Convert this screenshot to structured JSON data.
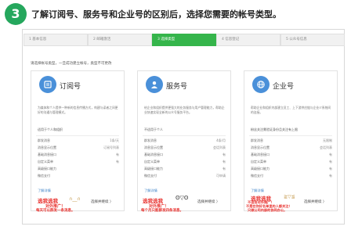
{
  "step_number": "3",
  "heading": "了解订阅号、服务号和企业号的区别后，选择您需要的帐号类型。",
  "steps": [
    {
      "label": "1 基本信息"
    },
    {
      "label": "2 邮箱激活"
    },
    {
      "label": "3 选择类型"
    },
    {
      "label": "4 信息登记"
    },
    {
      "label": "5 公众号信息"
    }
  ],
  "prompt": "请选择帐号类型，一旦成功建立帐号，类型不可更改",
  "cards": [
    {
      "title": "订阅号",
      "desc": "为媒体和个人提供一种新的信息传播方式，构建与读者之间更好的沟通与管理模式。",
      "note": "适用于个人和组织",
      "features": [
        {
          "label": "群发消息",
          "value": "1条/天"
        },
        {
          "label": "消息显示位置",
          "value": "订阅号列表"
        },
        {
          "label": "基础消息接口",
          "value": "有"
        },
        {
          "label": "自定义菜单",
          "value": "有"
        },
        {
          "label": "高级接口能力",
          "value": ""
        },
        {
          "label": "微信支付",
          "value": ""
        }
      ],
      "learn": "了解详情",
      "handwriting": [
        "选我选我",
        "对外推广！",
        "每天可以群发一条消息。"
      ],
      "face": "∩__∩",
      "select": "选择并继续 〉"
    },
    {
      "title": "服务号",
      "desc": "给企业和组织提供更强大的业务服务与用户管理能力，帮助企业快速实现全新的公众号服务平台。",
      "note": "不适用于个人",
      "features": [
        {
          "label": "群发消息",
          "value": "4条/月"
        },
        {
          "label": "消息显示位置",
          "value": "会话列表"
        },
        {
          "label": "基础消息接口",
          "value": "有"
        },
        {
          "label": "自定义菜单",
          "value": "有"
        },
        {
          "label": "高级接口能力",
          "value": "有"
        },
        {
          "label": "微信支付",
          "value": "可申请"
        }
      ],
      "learn": "了解详情",
      "handwriting": [
        "选我选我",
        "对外推广！",
        "每个月只能群发四条消息。"
      ],
      "face": "ʘ▽ʘ",
      "select": "选择并继续 〉"
    },
    {
      "title": "企业号",
      "desc": "帮助企业和组织内部建立员工、上下游供应链与企业IT系统间的连接。",
      "note": "粉丝关注需验证身份且关注有上限",
      "features": [
        {
          "label": "群发消息",
          "value": "无限制"
        },
        {
          "label": "消息显示位置",
          "value": "会话列表"
        },
        {
          "label": "基础消息接口",
          "value": "有"
        },
        {
          "label": "自定义菜单",
          "value": "有"
        },
        {
          "label": "高级接口能力",
          "value": "有"
        },
        {
          "label": "微信支付",
          "value": "有"
        }
      ],
      "learn": "了解详情",
      "handwriting": [
        "选我选我",
        "不适合对外推广！",
        "不是在你好名单里的人都关注！",
        "只做公司内部的协同办公。"
      ],
      "face": "≧▽≦",
      "select": "选择并继续 〉"
    }
  ],
  "colors": {
    "accent": "#25a75d",
    "active_step": "#35b54b",
    "icon_blue": "#4a90d9",
    "link": "#3a80c6",
    "handwriting": "#e8322f"
  },
  "icons": [
    "book-icon",
    "person-icon",
    "globe-icon"
  ]
}
